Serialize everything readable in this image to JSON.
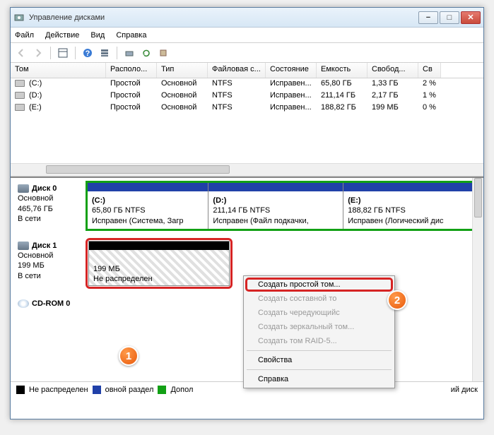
{
  "window": {
    "title": "Управление дисками"
  },
  "menu": {
    "file": "Файл",
    "action": "Действие",
    "view": "Вид",
    "help": "Справка"
  },
  "table": {
    "cols": {
      "volume": "Том",
      "layout": "Располо...",
      "type": "Тип",
      "fs": "Файловая с...",
      "state": "Состояние",
      "capacity": "Емкость",
      "free": "Свобод...",
      "pct": "Св"
    },
    "rows": [
      {
        "vol": "(C:)",
        "layout": "Простой",
        "type": "Основной",
        "fs": "NTFS",
        "state": "Исправен...",
        "cap": "65,80 ГБ",
        "free": "1,33 ГБ",
        "pct": "2 %"
      },
      {
        "vol": "(D:)",
        "layout": "Простой",
        "type": "Основной",
        "fs": "NTFS",
        "state": "Исправен...",
        "cap": "211,14 ГБ",
        "free": "2,17 ГБ",
        "pct": "1 %"
      },
      {
        "vol": "(E:)",
        "layout": "Простой",
        "type": "Основной",
        "fs": "NTFS",
        "state": "Исправен...",
        "cap": "188,82 ГБ",
        "free": "199 МБ",
        "pct": "0 %"
      }
    ]
  },
  "disks": {
    "d0": {
      "name": "Диск 0",
      "type": "Основной",
      "size": "465,76 ГБ",
      "status": "В сети"
    },
    "d1": {
      "name": "Диск 1",
      "type": "Основной",
      "size": "199 МБ",
      "status": "В сети"
    },
    "cd": {
      "name": "CD-ROM 0"
    }
  },
  "parts": {
    "c": {
      "label": "(C:)",
      "info": "65,80 ГБ NTFS",
      "state": "Исправен (Система, Загр"
    },
    "d": {
      "label": "(D:)",
      "info": "211,14 ГБ NTFS",
      "state": "Исправен (Файл подкачки,"
    },
    "e": {
      "label": "(E:)",
      "info": "188,82 ГБ NTFS",
      "state": "Исправен (Логический дис"
    },
    "unalloc": {
      "size": "199 МБ",
      "label": "Не распределен"
    }
  },
  "legend": {
    "unalloc": "Не распределен",
    "primary": "овной раздел",
    "ext": "Допол",
    "logical": "ий диск"
  },
  "ctx": {
    "simple": "Создать простой том...",
    "spanned": "Создать составной то",
    "striped": "Создать чередующийс",
    "mirror": "Создать зеркальный том...",
    "raid5": "Создать том RAID-5...",
    "props": "Свойства",
    "help": "Справка"
  },
  "badge": {
    "one": "1",
    "two": "2"
  }
}
